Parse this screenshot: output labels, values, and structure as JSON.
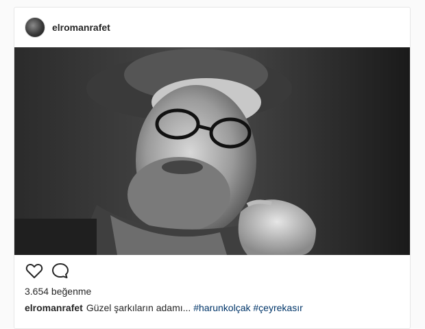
{
  "post": {
    "username": "elromanrafet",
    "photo_icon": "portrait-photo",
    "likes_text": "3.654 beğenme",
    "caption": {
      "username": "elromanrafet",
      "text": "Güzel şarkıların adamı...",
      "hashtags": [
        "#harunkolçak",
        "#çeyrekasır"
      ]
    },
    "icons": {
      "like": "heart-outline-icon",
      "comment": "comment-bubble-icon"
    }
  },
  "colors": {
    "background": "#fafafa",
    "card": "#ffffff",
    "border": "#e6e6e6",
    "text": "#262626",
    "hashtag": "#003569"
  }
}
